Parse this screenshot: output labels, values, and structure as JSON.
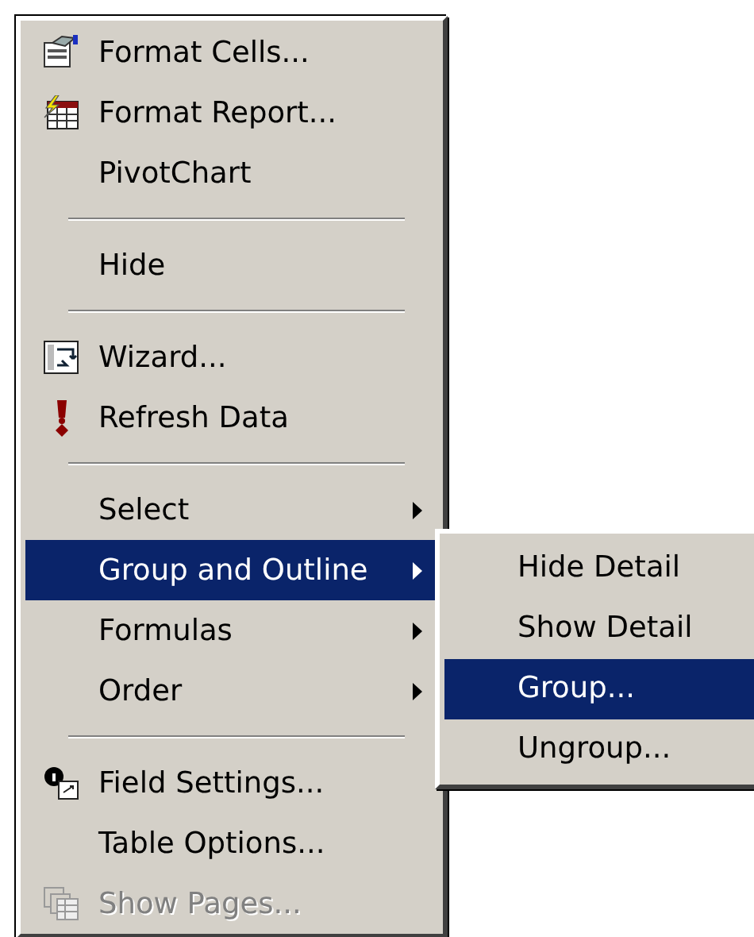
{
  "context_menu": {
    "items": [
      {
        "kind": "item",
        "label": "Format Cells...",
        "icon": true,
        "selected": false,
        "disabled": false
      },
      {
        "kind": "item",
        "label": "Format Report...",
        "icon": true,
        "selected": false,
        "disabled": false
      },
      {
        "kind": "item",
        "label": "PivotChart",
        "icon": false,
        "selected": false,
        "disabled": false
      },
      {
        "kind": "separator"
      },
      {
        "kind": "item",
        "label": "Hide",
        "icon": false,
        "selected": false,
        "disabled": false
      },
      {
        "kind": "separator"
      },
      {
        "kind": "item",
        "label": "Wizard...",
        "icon": true,
        "selected": false,
        "disabled": false
      },
      {
        "kind": "item",
        "label": "Refresh Data",
        "icon": true,
        "selected": false,
        "disabled": false
      },
      {
        "kind": "separator"
      },
      {
        "kind": "submenu",
        "label": "Select",
        "selected": false,
        "disabled": false
      },
      {
        "kind": "submenu",
        "label": "Group and Outline",
        "selected": true,
        "disabled": false
      },
      {
        "kind": "submenu",
        "label": "Formulas",
        "selected": false,
        "disabled": false
      },
      {
        "kind": "submenu",
        "label": "Order",
        "selected": false,
        "disabled": false
      },
      {
        "kind": "separator"
      },
      {
        "kind": "item",
        "label": "Field Settings...",
        "icon": true,
        "selected": false,
        "disabled": false
      },
      {
        "kind": "item",
        "label": "Table Options...",
        "icon": false,
        "selected": false,
        "disabled": false
      },
      {
        "kind": "item",
        "label": "Show Pages...",
        "icon": true,
        "selected": false,
        "disabled": true
      }
    ]
  },
  "submenu": {
    "items": [
      {
        "label": "Hide Detail",
        "selected": false
      },
      {
        "label": "Show Detail",
        "selected": false
      },
      {
        "label": "Group...",
        "selected": true
      },
      {
        "label": "Ungroup...",
        "selected": false
      }
    ]
  }
}
